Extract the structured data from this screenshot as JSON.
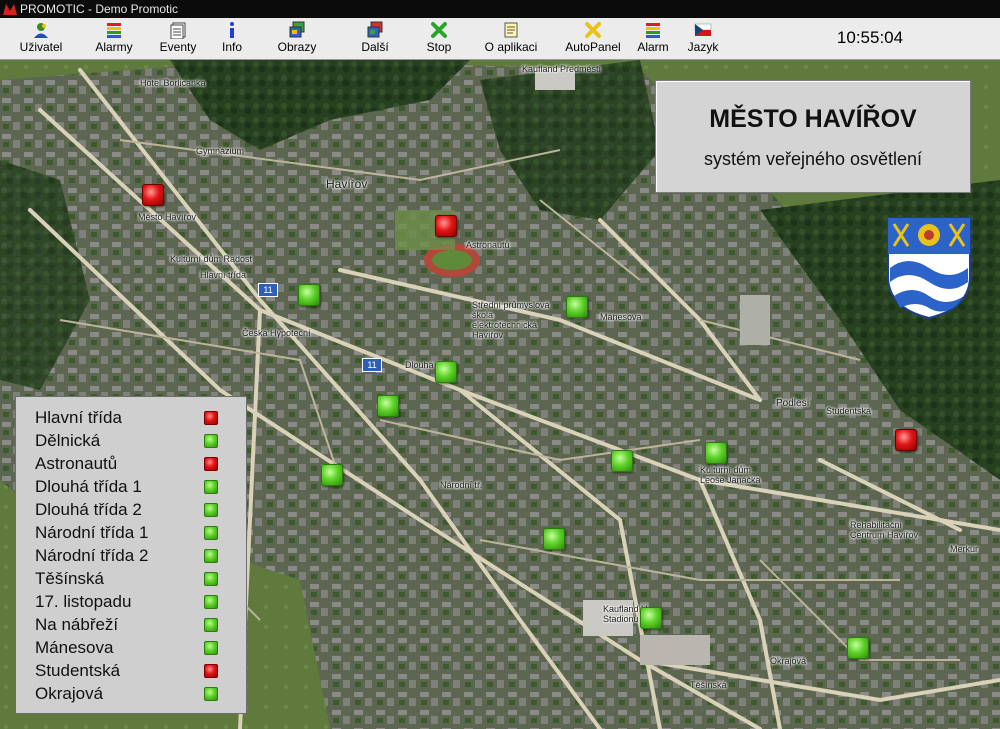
{
  "window": {
    "title": "PROMOTIC - Demo Promotic"
  },
  "toolbar": {
    "buttons": [
      {
        "label": "Uživatel",
        "icon": "user-icon"
      },
      {
        "label": "Alarmy",
        "icon": "alarms-icon"
      },
      {
        "label": "Eventy",
        "icon": "events-icon"
      },
      {
        "label": "Info",
        "icon": "info-icon"
      },
      {
        "label": "Obrazy",
        "icon": "screens-icon"
      },
      {
        "label": "Další",
        "icon": "next-icon"
      },
      {
        "label": "Stop",
        "icon": "stop-icon"
      },
      {
        "label": "O aplikaci",
        "icon": "about-icon"
      },
      {
        "label": "AutoPanel",
        "icon": "autopanel-icon"
      },
      {
        "label": "Alarm",
        "icon": "alarm-icon"
      },
      {
        "label": "Jazyk",
        "icon": "czech-flag-icon"
      }
    ],
    "clock": "10:55:04"
  },
  "panel": {
    "title": "MĚSTO HAVÍŘOV",
    "subtitle": "systém veřejného osvětlení"
  },
  "legend": {
    "items": [
      {
        "name": "Hlavní třída",
        "status": "red"
      },
      {
        "name": "Dělnická",
        "status": "green"
      },
      {
        "name": "Astronautů",
        "status": "red"
      },
      {
        "name": "Dlouhá třída 1",
        "status": "green"
      },
      {
        "name": "Dlouhá třída 2",
        "status": "green"
      },
      {
        "name": "Národní třída 1",
        "status": "green"
      },
      {
        "name": "Národní třída 2",
        "status": "green"
      },
      {
        "name": "Těšínská",
        "status": "green"
      },
      {
        "name": "17. listopadu",
        "status": "green"
      },
      {
        "name": "Na nábřeží",
        "status": "green"
      },
      {
        "name": "Mánesova",
        "status": "green"
      },
      {
        "name": "Studentská",
        "status": "red"
      },
      {
        "name": "Okrajová",
        "status": "green"
      }
    ]
  },
  "map_labels": {
    "hotel": "Hotel Borlicanka",
    "gymnazium": "Gymnázium",
    "havirov": "Havířov",
    "mesto_havirov": "Město Havířov",
    "kulturni_dum_radost": "Kulturní dům Radost",
    "ceska_hypotecni": "Česká Hypoteční",
    "kaufland_predmesti": "Kaufland Předměstí",
    "stredni_skola": "Střední průmyslová škola elektrotechnická Havířov",
    "kulturni_dum_janacka": "Kulturní dům Leoše Janáčka",
    "podlesi": "Podlesí",
    "rehabilitacni": "Rehabilitační Centrum Havířov",
    "merkur": "Merkur",
    "kaufland_stadion": "Kaufland U Stadionu",
    "dlouha_tr": "Dlouhá tř.",
    "narodni_tr": "Národní tř.",
    "manesova": "Mánesova",
    "studentska": "Studentská",
    "okrajova": "Okrajová",
    "tesinska": "Těšínská",
    "astronautu": "Astronautů",
    "hlavni_trida": "Hlavní třída",
    "badge_a": "11",
    "badge_b": "11"
  },
  "colors": {
    "lamp_ok": "#5ed12a",
    "lamp_fault": "#e01414",
    "titlebar": "#0b0b0b",
    "toolbar": "#ececec",
    "panel": "#d4d4d4",
    "crest_blue": "#2c63c9",
    "crest_gold": "#e8c21a"
  }
}
